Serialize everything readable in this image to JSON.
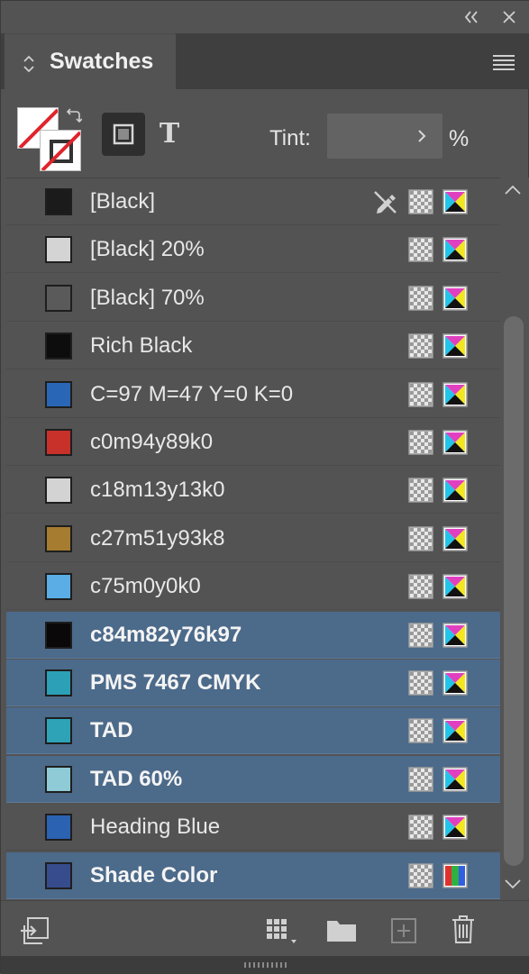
{
  "panel": {
    "title": "Swatches",
    "tint_label": "Tint:",
    "tint_value": "",
    "tint_unit": "%"
  },
  "swatches": [
    {
      "name": "[Black]",
      "color": "#1b1b1b",
      "selected": false,
      "locked": true,
      "mode": "cmyk"
    },
    {
      "name": "[Black] 20%",
      "color": "#d4d4d4",
      "selected": false,
      "locked": false,
      "mode": "cmyk"
    },
    {
      "name": "[Black] 70%",
      "color": "#5a5a5a",
      "selected": false,
      "locked": false,
      "mode": "cmyk"
    },
    {
      "name": "Rich Black",
      "color": "#0d0d0d",
      "selected": false,
      "locked": false,
      "mode": "cmyk"
    },
    {
      "name": "C=97 M=47 Y=0 K=0",
      "color": "#2a66b6",
      "selected": false,
      "locked": false,
      "mode": "cmyk"
    },
    {
      "name": "c0m94y89k0",
      "color": "#c8302a",
      "selected": false,
      "locked": false,
      "mode": "cmyk"
    },
    {
      "name": "c18m13y13k0",
      "color": "#d3d3d3",
      "selected": false,
      "locked": false,
      "mode": "cmyk"
    },
    {
      "name": "c27m51y93k8",
      "color": "#a67c30",
      "selected": false,
      "locked": false,
      "mode": "cmyk"
    },
    {
      "name": "c75m0y0k0",
      "color": "#5aaee5",
      "selected": false,
      "locked": false,
      "mode": "cmyk"
    },
    {
      "name": "c84m82y76k97",
      "color": "#0a0808",
      "selected": true,
      "locked": false,
      "mode": "cmyk"
    },
    {
      "name": "PMS 7467 CMYK",
      "color": "#2ba0b6",
      "selected": true,
      "locked": false,
      "mode": "cmyk"
    },
    {
      "name": "TAD",
      "color": "#2ea3b8",
      "selected": true,
      "locked": false,
      "mode": "cmyk"
    },
    {
      "name": "TAD 60%",
      "color": "#8ecbd6",
      "selected": true,
      "locked": false,
      "mode": "cmyk"
    },
    {
      "name": "Heading Blue",
      "color": "#2b62b2",
      "selected": false,
      "locked": false,
      "mode": "cmyk"
    },
    {
      "name": "Shade Color",
      "color": "#364c8c",
      "selected": true,
      "locked": false,
      "mode": "rgb"
    }
  ],
  "icons": {
    "collapse": "double-chevron-left-icon",
    "close": "close-icon",
    "menu": "hamburger-menu-icon",
    "fill": "fill-none-icon",
    "stroke": "stroke-none-icon",
    "swap": "swap-fill-stroke-icon",
    "container": "formatting-affects-container-icon",
    "text": "formatting-affects-text-icon",
    "noedit": "pencil-slash-icon",
    "process": "process-color-icon",
    "cmyk": "cmyk-mode-icon",
    "rgb": "rgb-mode-icon",
    "show": "show-swatch-views-icon",
    "new_group": "new-color-group-icon",
    "new_swatch": "new-swatch-icon",
    "delete": "trash-icon",
    "add_to_cc": "add-to-library-icon"
  },
  "colors": {
    "panel_bg": "#535353",
    "selection": "#4c6a8a",
    "none_slash": "#e0242c"
  }
}
